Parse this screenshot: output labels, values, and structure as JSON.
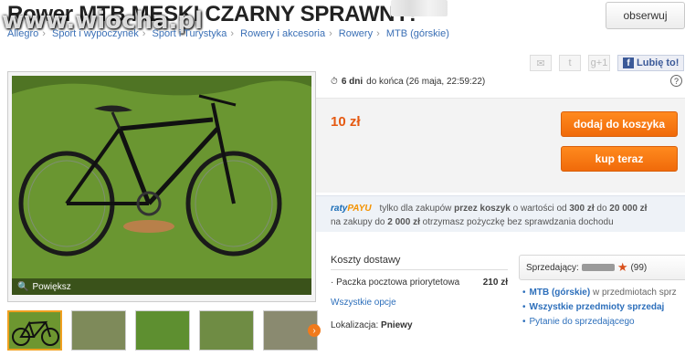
{
  "header": {
    "title": "Rower MTB MĘSKI CZARNY SPRAWNY!",
    "watermark": "www.wiocha.pl",
    "watch_label": "obserwuj"
  },
  "breadcrumb": [
    "Allegro",
    "Sport i wypoczynek",
    "Sport i Turystyka",
    "Rowery i akcesoria",
    "Rowery",
    "MTB (górskie)"
  ],
  "share": {
    "gplus_label": "g+1",
    "like_label": "Lubię to!",
    "icons": [
      "mail-icon",
      "twitter-icon"
    ]
  },
  "photo": {
    "zoom_label": "Powiększ"
  },
  "auction": {
    "time_days": "6 dni",
    "time_rest": "do końca (26 maja, 22:59:22)",
    "price": "10 zł",
    "add_to_cart": "dodaj do koszyka",
    "buy_now": "kup teraz"
  },
  "raty": {
    "logo_a": "raty",
    "logo_b": "PAYU",
    "line1_a": "tylko dla zakupów",
    "line1_b": "przez koszyk",
    "line1_c": "o wartości od",
    "line1_min": "300 zł",
    "line1_d": "do",
    "line1_max": "20 000 zł",
    "line2_a": "na zakupy do",
    "line2_amt": "2 000 zł",
    "line2_b": "otrzymasz pożyczkę bez sprawdzania dochodu"
  },
  "shipping": {
    "heading": "Koszty dostawy",
    "option_label": "Paczka pocztowa priorytetowa",
    "option_price": "210 zł",
    "all_options": "Wszystkie opcje",
    "location_label": "Lokalizacja:",
    "location_value": "Pniewy"
  },
  "seller": {
    "label": "Sprzedający:",
    "rating": "(99)",
    "links": [
      {
        "bold": "MTB (górskie)",
        "rest": "w przedmiotach sprz"
      },
      {
        "bold": "Wszystkie przedmioty sprzedaj",
        "rest": ""
      },
      {
        "bold": "",
        "rest": "Pytanie do sprzedającego"
      }
    ]
  }
}
